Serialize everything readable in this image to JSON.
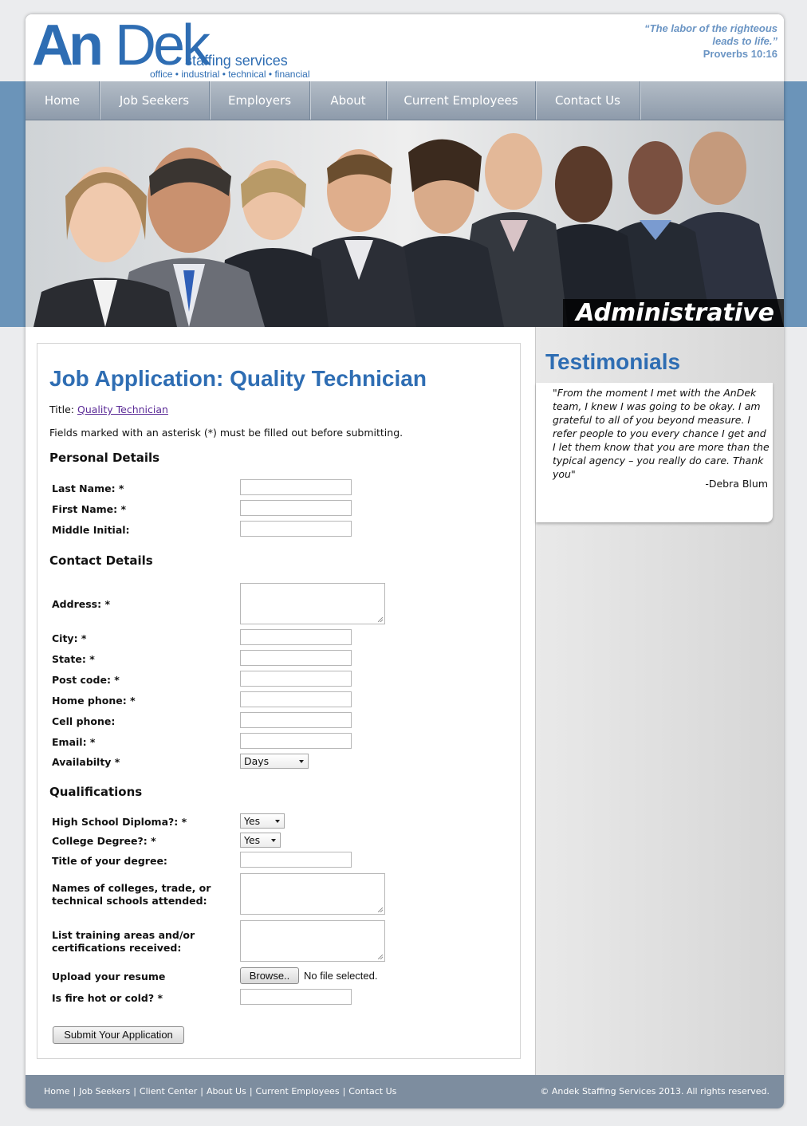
{
  "brand": {
    "logo_an": "An",
    "logo_dek": "Dek",
    "logo_staffing": "staffing services",
    "logo_tagline": "office • industrial • technical • financial",
    "quote_line1": "“The labor of the righteous",
    "quote_line2": "leads to life.”",
    "quote_ref": "Proverbs 10:16",
    "accent_color": "#2e6db3"
  },
  "nav": {
    "items": [
      "Home",
      "Job Seekers",
      "Employers",
      "About",
      "Current Employees",
      "Contact Us"
    ]
  },
  "banner": {
    "label": "Administrative"
  },
  "job": {
    "heading": "Job Application: Quality Technician",
    "title_label": "Title:",
    "title_link": "Quality Technician",
    "required_note": "Fields marked with an asterisk (*) must be filled out before submitting."
  },
  "sections": {
    "personal": "Personal Details",
    "contact": "Contact Details",
    "qualifications": "Qualifications"
  },
  "fields": {
    "last_name": "Last Name: *",
    "first_name": "First Name: *",
    "middle_initial": "Middle Initial:",
    "address": "Address: *",
    "city": "City: *",
    "state": "State: *",
    "post_code": "Post code: *",
    "home_phone": "Home phone: *",
    "cell_phone": "Cell phone:",
    "email": "Email: *",
    "availability": "Availabilty *",
    "availability_value": "Days",
    "hs_diploma": "High School Diploma?: *",
    "hs_diploma_value": "Yes",
    "college_degree": "College Degree?: *",
    "college_degree_value": "Yes",
    "degree_title": "Title of your degree:",
    "schools_line1": "Names of colleges, trade, or",
    "schools_line2": "technical schools attended:",
    "training_line1": "List training areas and/or",
    "training_line2": "certifications received:",
    "resume": "Upload your resume",
    "browse_label": "Browse..",
    "no_file": "No file selected.",
    "captcha": "Is fire hot or cold? *",
    "submit_label": "Submit Your Application"
  },
  "testimonials": {
    "heading": "Testimonials",
    "text": "\"From the moment I met with the AnDek team, I knew I was going to be okay. I am grateful to all of you beyond measure. I refer people to you every chance I get and I let them know that you are more than the typical agency – you really do care. Thank you\"",
    "author": "-Debra Blum"
  },
  "footer": {
    "links": [
      "Home",
      "Job Seekers",
      "Client Center",
      "About Us",
      "Current Employees",
      "Contact Us"
    ],
    "copyright": "© Andek Staffing Services 2013. All rights reserved."
  }
}
